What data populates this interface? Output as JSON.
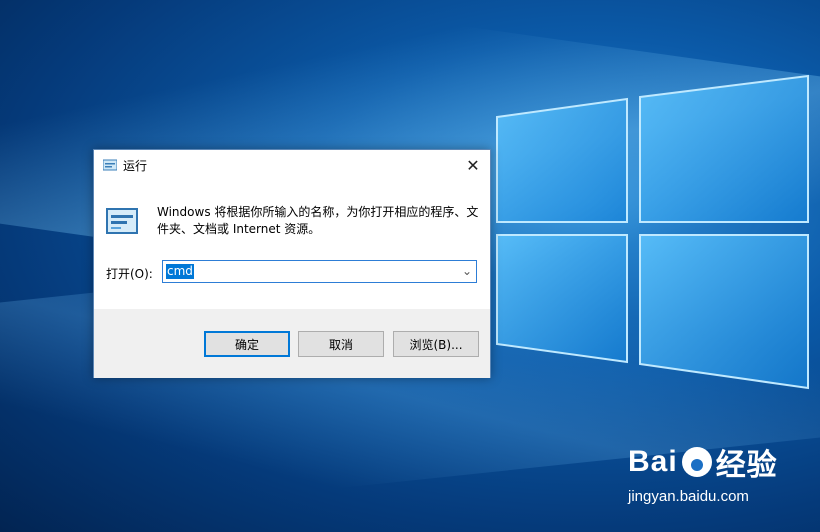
{
  "dialog": {
    "title": "运行",
    "description": "Windows 将根据你所输入的名称，为你打开相应的程序、文件夹、文档或 Internet 资源。",
    "open_label": "打开(O):",
    "input_value": "cmd",
    "buttons": {
      "ok": "确定",
      "cancel": "取消",
      "browse": "浏览(B)..."
    },
    "close_icon": "close-icon",
    "accent": "#0078d7"
  },
  "watermark": {
    "brand": "Bai",
    "brand_suffix": "经验",
    "url": "jingyan.baidu.com"
  }
}
